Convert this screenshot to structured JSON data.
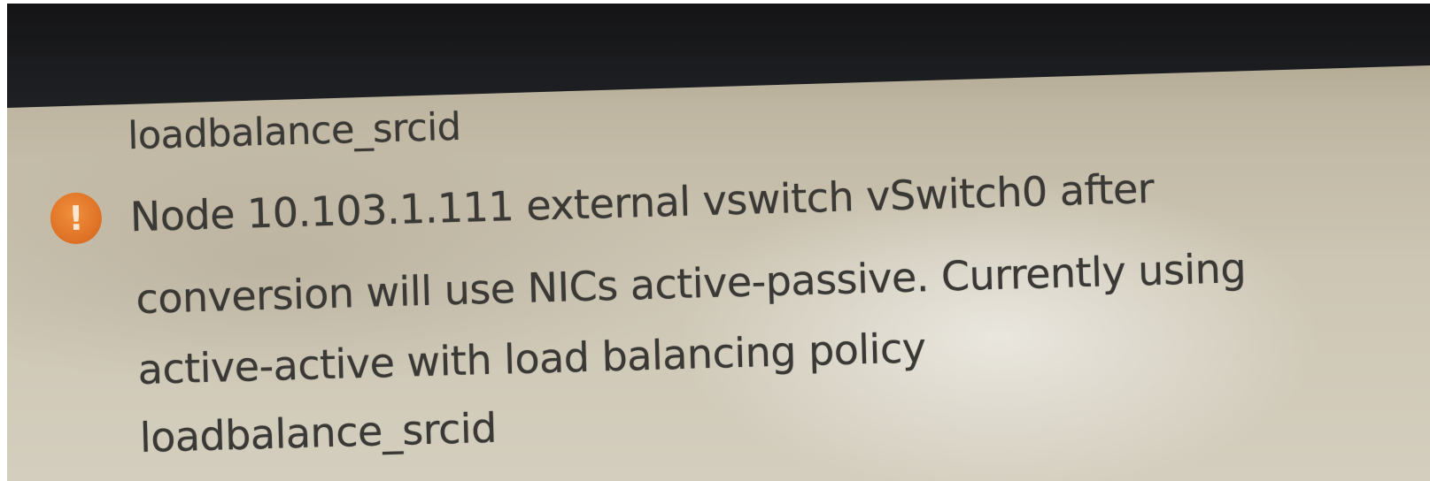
{
  "alert": {
    "lines": [
      "loadbalance_srcid",
      "Node 10.103.1.111 external vswitch vSwitch0 after",
      "conversion will use NICs active-passive. Currently using",
      "active-active with load balancing policy",
      "loadbalance_srcid"
    ],
    "icon": "warning-icon",
    "icon_glyph": "!",
    "icon_color": "#e07a2c"
  },
  "colors": {
    "top_band": "#1b1c1f",
    "panel": "#c9c2ae",
    "text": "#3a3936"
  }
}
